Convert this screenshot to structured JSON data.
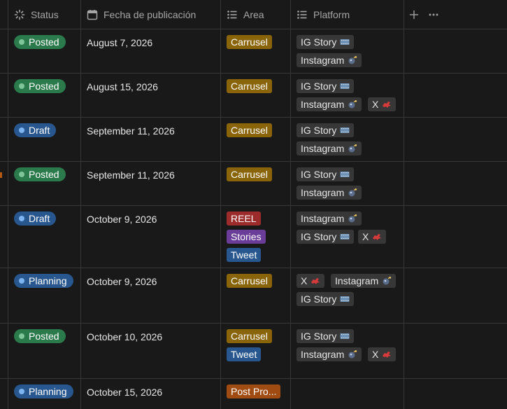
{
  "header": {
    "columns": [
      {
        "label": "Status",
        "icon": "status-loader-icon"
      },
      {
        "label": "Fecha de publicación",
        "icon": "calendar-icon"
      },
      {
        "label": "Area",
        "icon": "list-icon"
      },
      {
        "label": "Platform",
        "icon": "list-icon"
      }
    ],
    "add_icon": "plus-icon",
    "more_icon": "more-horizontal-icon"
  },
  "colors": {
    "posted": "#2b7a4b",
    "draft": "#28578f",
    "planning": "#28578f",
    "carrusel": "#8a6408",
    "reel": "#9c2b2b",
    "stories": "#6a3d99",
    "tweet": "#28578f",
    "post_pro": "#a04b12",
    "platform_tag": "#373737"
  },
  "rows": [
    {
      "status": "Posted",
      "date": "August 7, 2026",
      "area": [
        "Carrusel"
      ],
      "platform_lines": [
        [
          "IG Story"
        ],
        [
          "Instagram"
        ]
      ]
    },
    {
      "status": "Posted",
      "date": "August 15, 2026",
      "area": [
        "Carrusel"
      ],
      "platform_lines": [
        [
          "IG Story"
        ],
        [
          "Instagram",
          "X"
        ]
      ]
    },
    {
      "status": "Draft",
      "date": "September 11, 2026",
      "area": [
        "Carrusel"
      ],
      "platform_lines": [
        [
          "IG Story"
        ],
        [
          "Instagram"
        ]
      ]
    },
    {
      "status": "Posted",
      "date": "September 11, 2026",
      "area": [
        "Carrusel"
      ],
      "platform_lines": [
        [
          "IG Story"
        ],
        [
          "Instagram"
        ]
      ]
    },
    {
      "status": "Draft",
      "date": "October 9, 2026",
      "area": [
        "REEL",
        "Stories",
        "Tweet"
      ],
      "platform_lines": [
        [
          "Instagram"
        ],
        [
          "IG Story",
          "X"
        ]
      ]
    },
    {
      "status": "Planning",
      "date": "October 9, 2026",
      "area": [
        "Carrusel"
      ],
      "platform_lines": [
        [
          "X",
          "Instagram"
        ],
        [
          "IG Story"
        ]
      ]
    },
    {
      "status": "Posted",
      "date": "October 10, 2026",
      "area": [
        "Carrusel",
        "Tweet"
      ],
      "platform_lines": [
        [
          "IG Story"
        ],
        [
          "Instagram",
          "X"
        ]
      ]
    },
    {
      "status": "Planning",
      "date": "October 15, 2026",
      "area": [
        "Post Pro..."
      ],
      "platform_lines": []
    }
  ]
}
